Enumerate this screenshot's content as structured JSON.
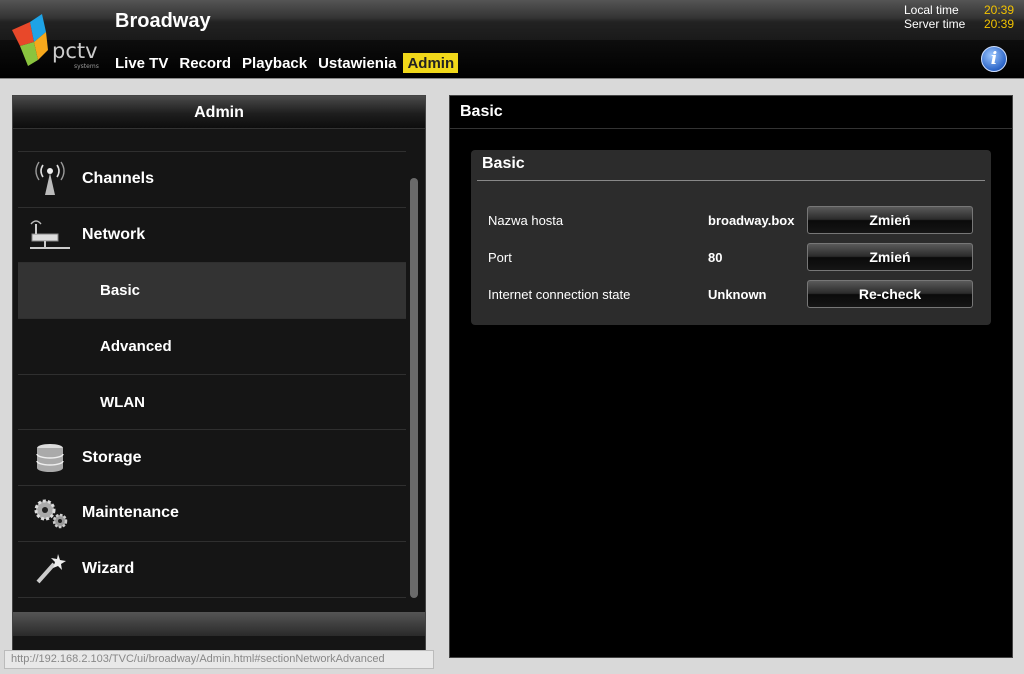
{
  "app": {
    "title": "Broadway",
    "logo_text": "pctv",
    "logo_sub": "systems"
  },
  "clock": {
    "local_label": "Local time",
    "local_value": "20:39",
    "server_label": "Server time",
    "server_value": "20:39"
  },
  "nav": {
    "items": [
      {
        "label": "Live TV"
      },
      {
        "label": "Record"
      },
      {
        "label": "Playback"
      },
      {
        "label": "Ustawienia"
      },
      {
        "label": "Admin",
        "active": true
      }
    ]
  },
  "sidebar": {
    "title": "Admin",
    "items": [
      {
        "label": "Channels",
        "icon": "antenna-icon"
      },
      {
        "label": "Network",
        "icon": "network-icon"
      },
      {
        "label": "Basic",
        "sub": true,
        "selected": true
      },
      {
        "label": "Advanced",
        "sub": true
      },
      {
        "label": "WLAN",
        "sub": true
      },
      {
        "label": "Storage",
        "icon": "database-icon"
      },
      {
        "label": "Maintenance",
        "icon": "gears-icon"
      },
      {
        "label": "Wizard",
        "icon": "magic-wand-icon"
      }
    ]
  },
  "status_bar": {
    "url": "http://192.168.2.103/TVC/ui/broadway/Admin.html#sectionNetworkAdvanced"
  },
  "main": {
    "title": "Basic",
    "box_title": "Basic",
    "rows": [
      {
        "label": "Nazwa hosta",
        "value": "broadway.box",
        "button": "Zmień"
      },
      {
        "label": "Port",
        "value": "80",
        "button": "Zmień"
      },
      {
        "label": "Internet connection state",
        "value": "Unknown",
        "button": "Re-check"
      }
    ]
  },
  "colors": {
    "accent": "#f1d81a",
    "time": "#f2c200",
    "info": "#2c65c8"
  }
}
